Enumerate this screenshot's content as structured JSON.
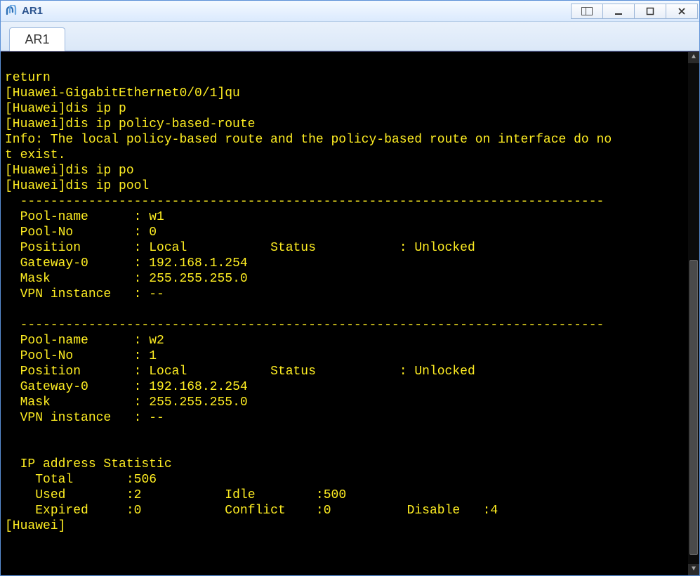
{
  "window": {
    "title": "AR1"
  },
  "tabs": [
    {
      "label": "AR1"
    }
  ],
  "terminal": {
    "lines": [
      "return",
      "[Huawei-GigabitEthernet0/0/1]qu",
      "[Huawei]dis ip p",
      "[Huawei]dis ip policy-based-route",
      "Info: The local policy-based route and the policy-based route on interface do no",
      "t exist.",
      "[Huawei]dis ip po",
      "[Huawei]dis ip pool"
    ],
    "separator": "  -----------------------------------------------------------------------------",
    "pools": [
      {
        "name": "w1",
        "no": "0",
        "position": "Local",
        "status": "Unlocked",
        "gateway0": "192.168.1.254",
        "mask": "255.255.255.0",
        "vpn_instance": "--"
      },
      {
        "name": "w2",
        "no": "1",
        "position": "Local",
        "status": "Unlocked",
        "gateway0": "192.168.2.254",
        "mask": "255.255.255.0",
        "vpn_instance": "--"
      }
    ],
    "stat_title": "  IP address Statistic",
    "stats": {
      "total": "506",
      "used": "2",
      "idle": "500",
      "expired": "0",
      "conflict": "0",
      "disable": "4"
    },
    "final_prompt": "[Huawei]"
  },
  "labels": {
    "pool_name": "Pool-name",
    "pool_no": "Pool-No",
    "position": "Position",
    "status": "Status",
    "gateway0": "Gateway-0",
    "mask": "Mask",
    "vpn_instance": "VPN instance",
    "total": "Total",
    "used": "Used",
    "idle": "Idle",
    "expired": "Expired",
    "conflict": "Conflict",
    "disable": "Disable"
  }
}
